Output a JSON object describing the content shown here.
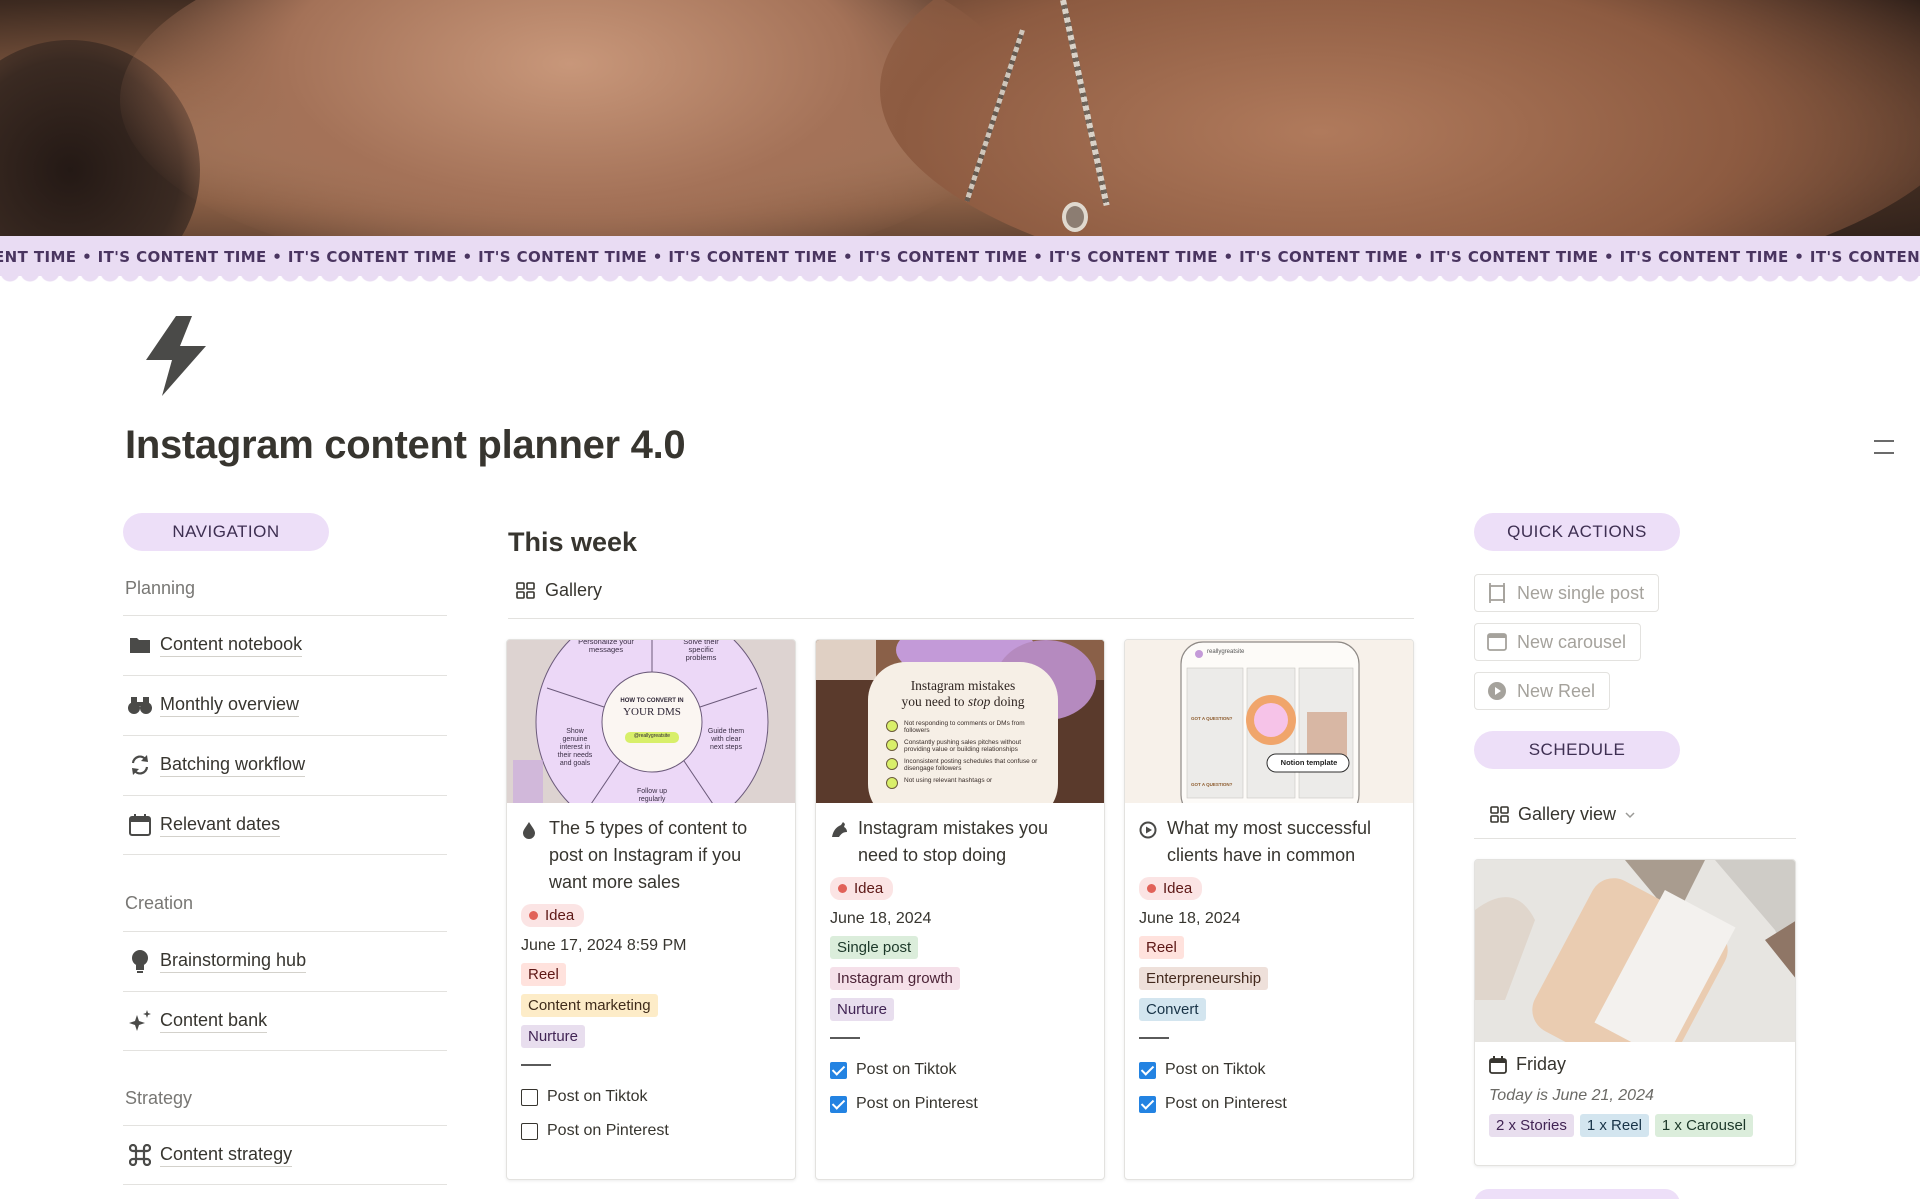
{
  "ticker": {
    "text": "ENT TIME • IT'S CONTENT TIME • IT'S CONTENT TIME • IT'S CONTENT TIME • IT'S CONTENT TIME • IT'S CONTENT TIME • IT'S CONTENT TIME • IT'S CONTENT TIME • IT'S CONTENT TIME • IT'S CONTENT TIME • IT'S CONTENT TIME • IT'S CONTENT TIME • IT'S"
  },
  "page": {
    "title": "Instagram content planner 4.0",
    "icon": "lightning-bolt-icon"
  },
  "navigation": {
    "pill_label": "NAVIGATION",
    "groups": [
      {
        "title": "Planning",
        "items": [
          {
            "label": "Content notebook",
            "icon": "folder-icon"
          },
          {
            "label": "Monthly overview",
            "icon": "binoculars-icon"
          },
          {
            "label": "Batching workflow",
            "icon": "refresh-icon"
          },
          {
            "label": "Relevant dates",
            "icon": "calendar-icon"
          }
        ]
      },
      {
        "title": "Creation",
        "items": [
          {
            "label": "Brainstorming hub",
            "icon": "lightbulb-icon"
          },
          {
            "label": "Content bank",
            "icon": "sparkles-icon"
          }
        ]
      },
      {
        "title": "Strategy",
        "items": [
          {
            "label": "Content strategy",
            "icon": "command-icon"
          }
        ]
      }
    ]
  },
  "this_week": {
    "title": "This week",
    "view_label": "Gallery",
    "cards": [
      {
        "title": "The 5 types of content to post on Instagram if you want more sales",
        "icon": "drop-icon",
        "status": "Idea",
        "date": "June 17, 2024 8:59 PM",
        "tags": [
          "Reel",
          "Content marketing",
          "Nurture"
        ],
        "checks": [
          {
            "label": "Post on Tiktok",
            "checked": false
          },
          {
            "label": "Post on Pinterest",
            "checked": false
          }
        ],
        "thumb": {
          "top_left": "Personalize your messages",
          "top_right": "Solve their specific problems",
          "center_small": "HOW TO CONVERT IN",
          "center_big": "YOUR DMS",
          "handle": "@reallygreatsite",
          "left": "Show genuine interest in their needs and goals",
          "right": "Guide them with clear next steps",
          "bottom": "Follow up regularly"
        }
      },
      {
        "title": "Instagram mistakes you need to stop doing",
        "icon": "bird-icon",
        "status": "Idea",
        "date": "June 18, 2024",
        "tags": [
          "Single post",
          "Instagram growth",
          "Nurture"
        ],
        "checks": [
          {
            "label": "Post on Tiktok",
            "checked": true
          },
          {
            "label": "Post on Pinterest",
            "checked": true
          }
        ],
        "thumb": {
          "heading1": "Instagram mistakes",
          "heading2a": "you need to ",
          "heading2b": "stop",
          "heading2c": " doing",
          "lines": [
            "Not responding to comments or DMs from followers",
            "Constantly pushing sales pitches without providing value or building relationships",
            "Inconsistent posting schedules that confuse or disengage followers",
            "Not using relevant hashtags or"
          ]
        }
      },
      {
        "title": "What my most successful clients have in common",
        "icon": "play-circle-icon",
        "status": "Idea",
        "date": "June 18, 2024",
        "tags": [
          "Reel",
          "Enterpreneurship",
          "Convert"
        ],
        "checks": [
          {
            "label": "Post on Tiktok",
            "checked": true
          },
          {
            "label": "Post on Pinterest",
            "checked": true
          }
        ],
        "thumb": {
          "site": "reallygreatsite",
          "badge": "Notion template",
          "tag1": "GOT A QUESTION?",
          "tag2": "GOT A QUESTION?"
        }
      }
    ]
  },
  "quick_actions": {
    "pill_label": "QUICK ACTIONS",
    "buttons": [
      {
        "label": "New single post",
        "icon": "frame-icon"
      },
      {
        "label": "New carousel",
        "icon": "window-icon"
      },
      {
        "label": "New Reel",
        "icon": "play-circle-icon"
      }
    ]
  },
  "schedule": {
    "pill_label": "SCHEDULE",
    "view_label": "Gallery view",
    "card": {
      "title": "Friday",
      "subtitle": "Today is June 21, 2024",
      "tags": [
        "2 x Stories",
        "1 x Reel",
        "1 x Carousel"
      ]
    }
  },
  "colors": {
    "accent_pill": "#eddff8",
    "ticker_bg": "#e9dcf3",
    "idea_dot": "#e16259",
    "checkbox_blue": "#2383e2"
  }
}
